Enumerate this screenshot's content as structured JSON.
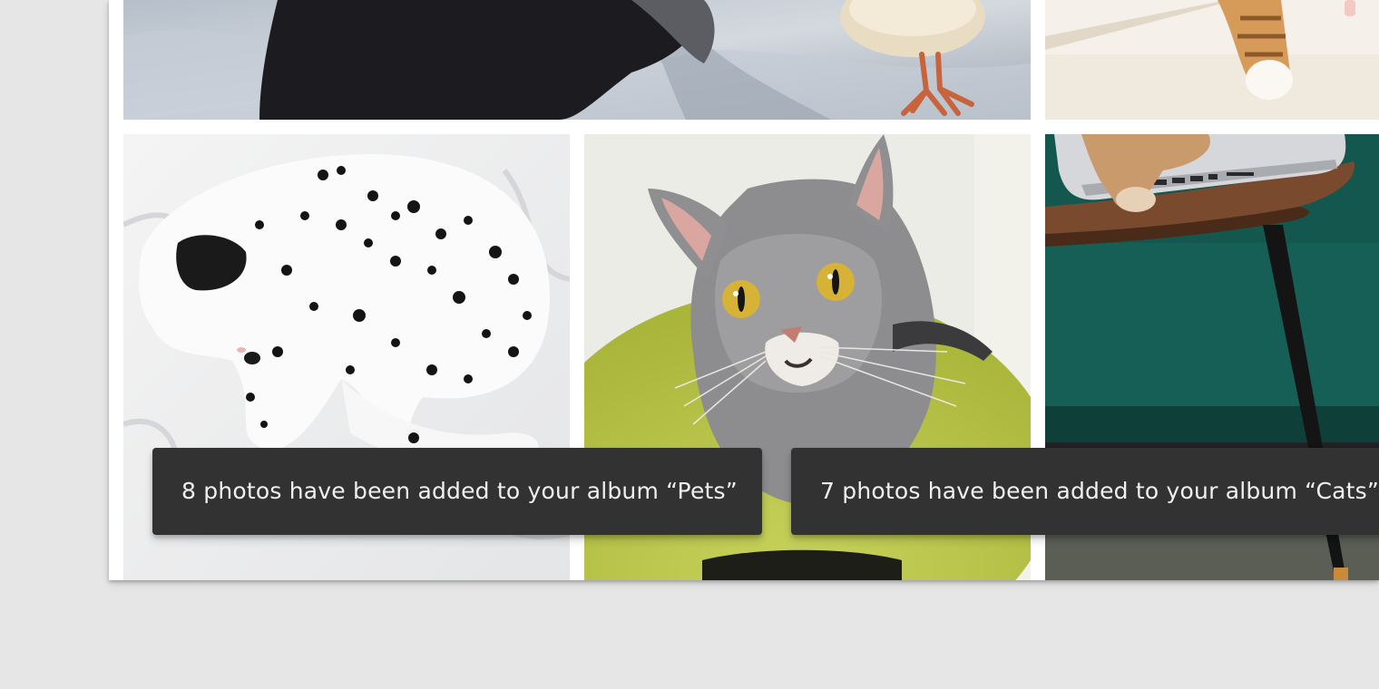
{
  "gallery": {
    "photos": [
      {
        "name": "dog-and-chick-photo"
      },
      {
        "name": "cat-paws-photo"
      },
      {
        "name": "sleeping-dalmatian-photo"
      },
      {
        "name": "grey-cat-photo"
      },
      {
        "name": "cat-on-laptop-table-photo"
      }
    ]
  },
  "snackbars": [
    {
      "message": "8 photos have been added to your album “Pets”"
    },
    {
      "message": "7 photos have been added to your album “Cats”"
    }
  ],
  "colors": {
    "background": "#e6e6e6",
    "card": "#ffffff",
    "snackbar": "#323232",
    "snackbar_text": "#f0f0f0"
  }
}
